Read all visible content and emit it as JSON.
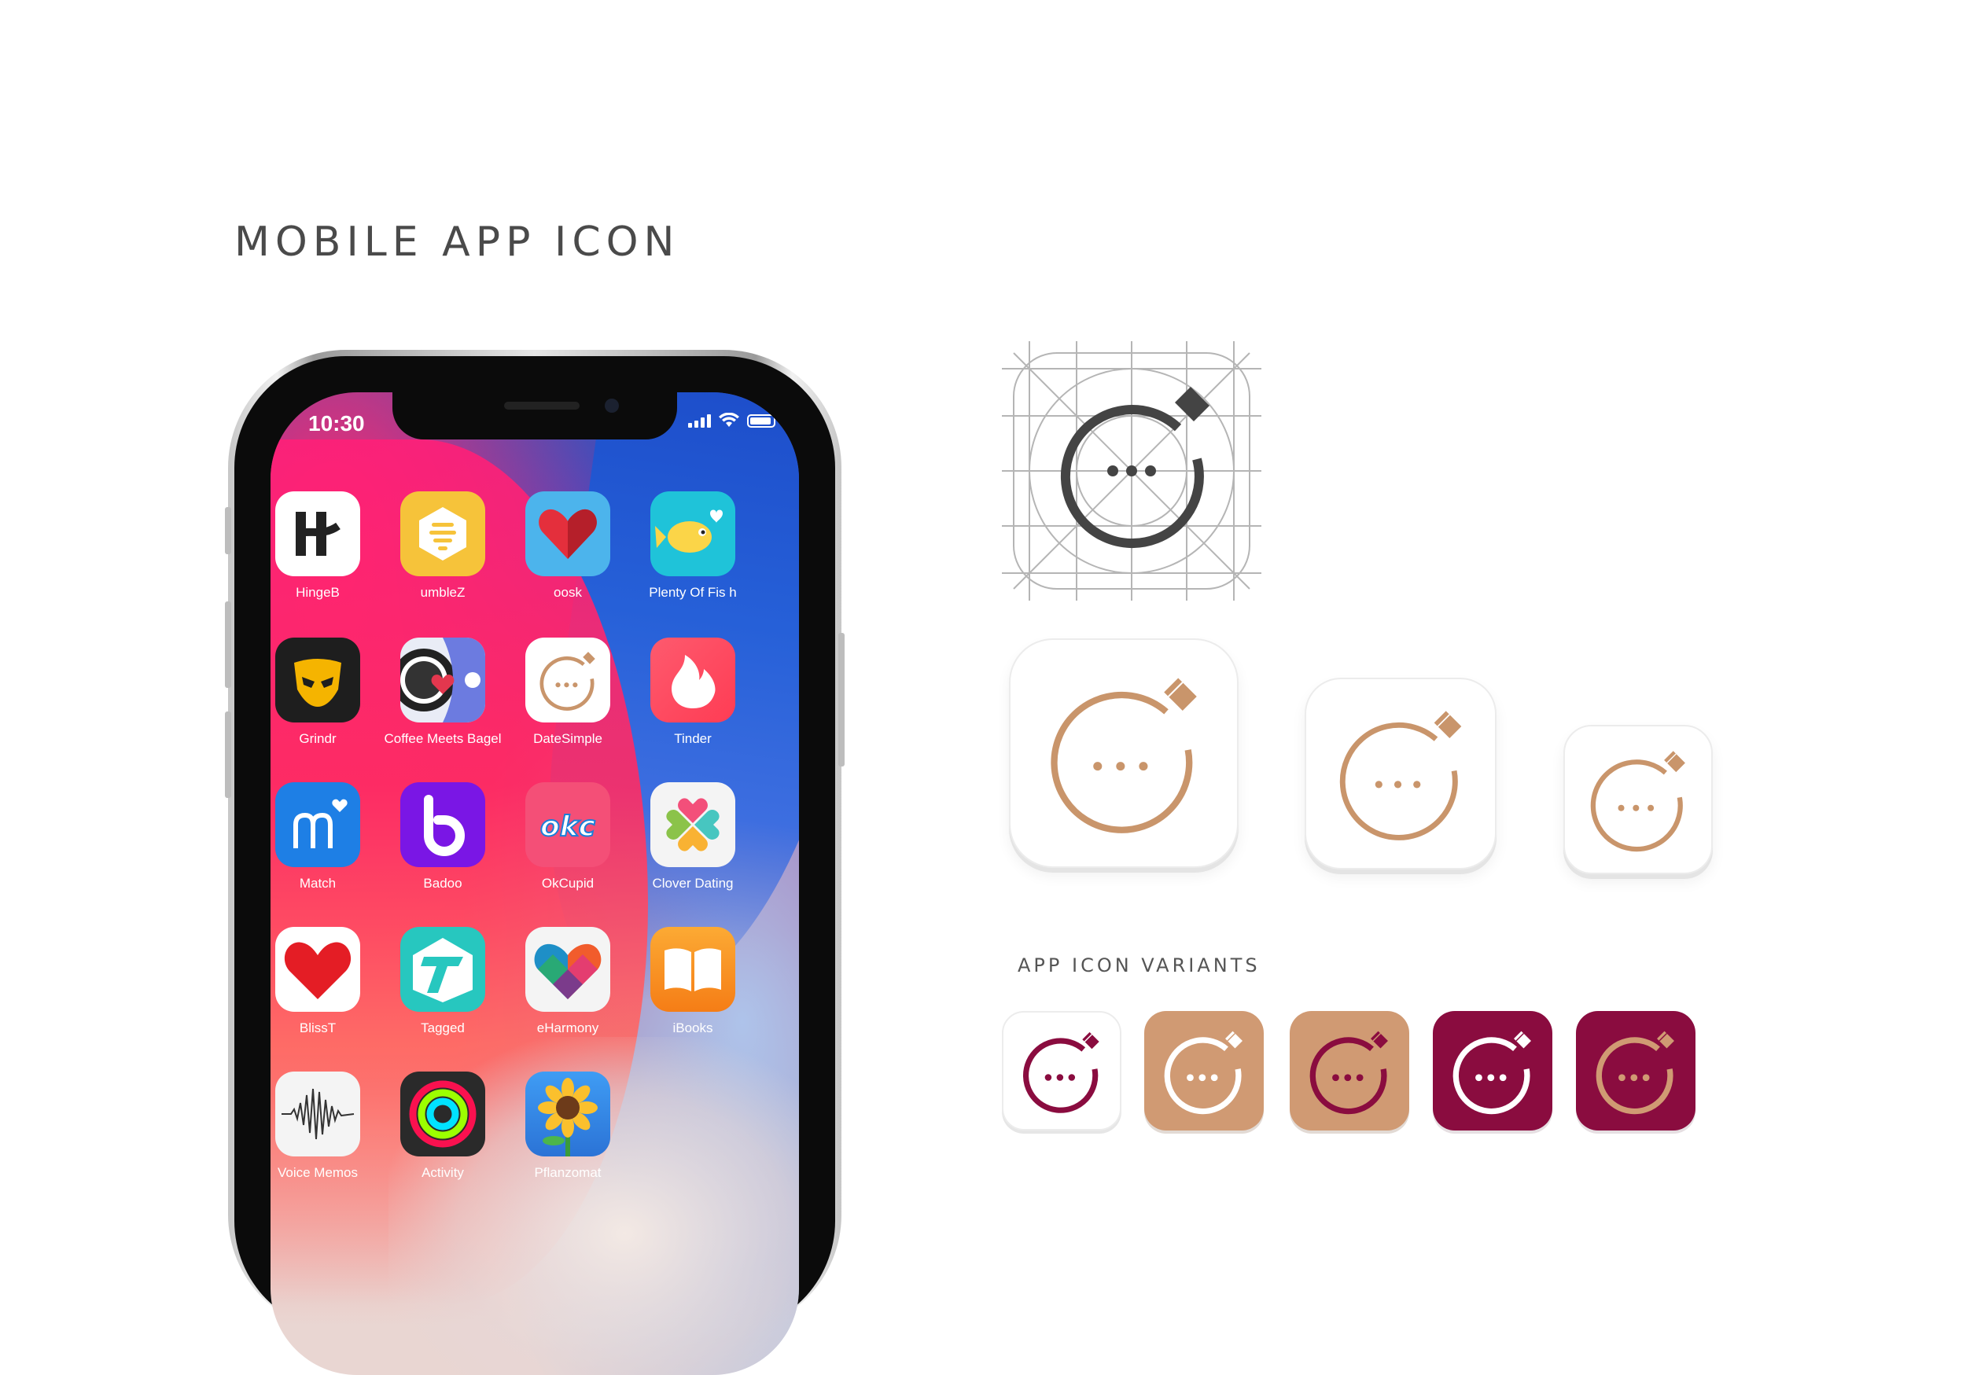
{
  "page": {
    "title": "MOBILE APP ICON",
    "variants_label": "APP ICON VARIANTS"
  },
  "colors": {
    "rose_gold": "#c9956b",
    "burgundy": "#8a0c3f",
    "grid_dark": "#444444",
    "grid_line": "#b5b5b5"
  },
  "phone": {
    "status_time": "10:30",
    "apps": [
      {
        "label": "HingeB",
        "icon": "hinge-icon"
      },
      {
        "label": "umbleZ",
        "icon": "bumble-icon"
      },
      {
        "label": "oosk",
        "icon": "heart-icon"
      },
      {
        "label": "Plenty Of Fis h",
        "icon": "fish-icon"
      },
      {
        "label": "Grindr",
        "icon": "grindr-mask-icon"
      },
      {
        "label": "Coffee Meets Bagel",
        "icon": "coffee-meets-bagel-icon"
      },
      {
        "label": "DateSimple",
        "icon": "datesimple-ring-icon"
      },
      {
        "label": "Tinder",
        "icon": "flame-icon"
      },
      {
        "label": "Match",
        "icon": "match-icon"
      },
      {
        "label": "Badoo",
        "icon": "badoo-icon"
      },
      {
        "label": "OkCupid",
        "icon": "okcupid-icon"
      },
      {
        "label": "Clover Dating",
        "icon": "clover-icon"
      },
      {
        "label": "BlissT",
        "icon": "heart-icon"
      },
      {
        "label": "Tagged",
        "icon": "tagged-icon"
      },
      {
        "label": "eHarmony",
        "icon": "eharmony-icon"
      },
      {
        "label": "iBooks",
        "icon": "book-icon"
      },
      {
        "label": "Voice Memos",
        "icon": "waveform-icon"
      },
      {
        "label": "Activity",
        "icon": "activity-rings-icon"
      },
      {
        "label": "Pflanzomat",
        "icon": "sunflower-icon"
      }
    ]
  }
}
